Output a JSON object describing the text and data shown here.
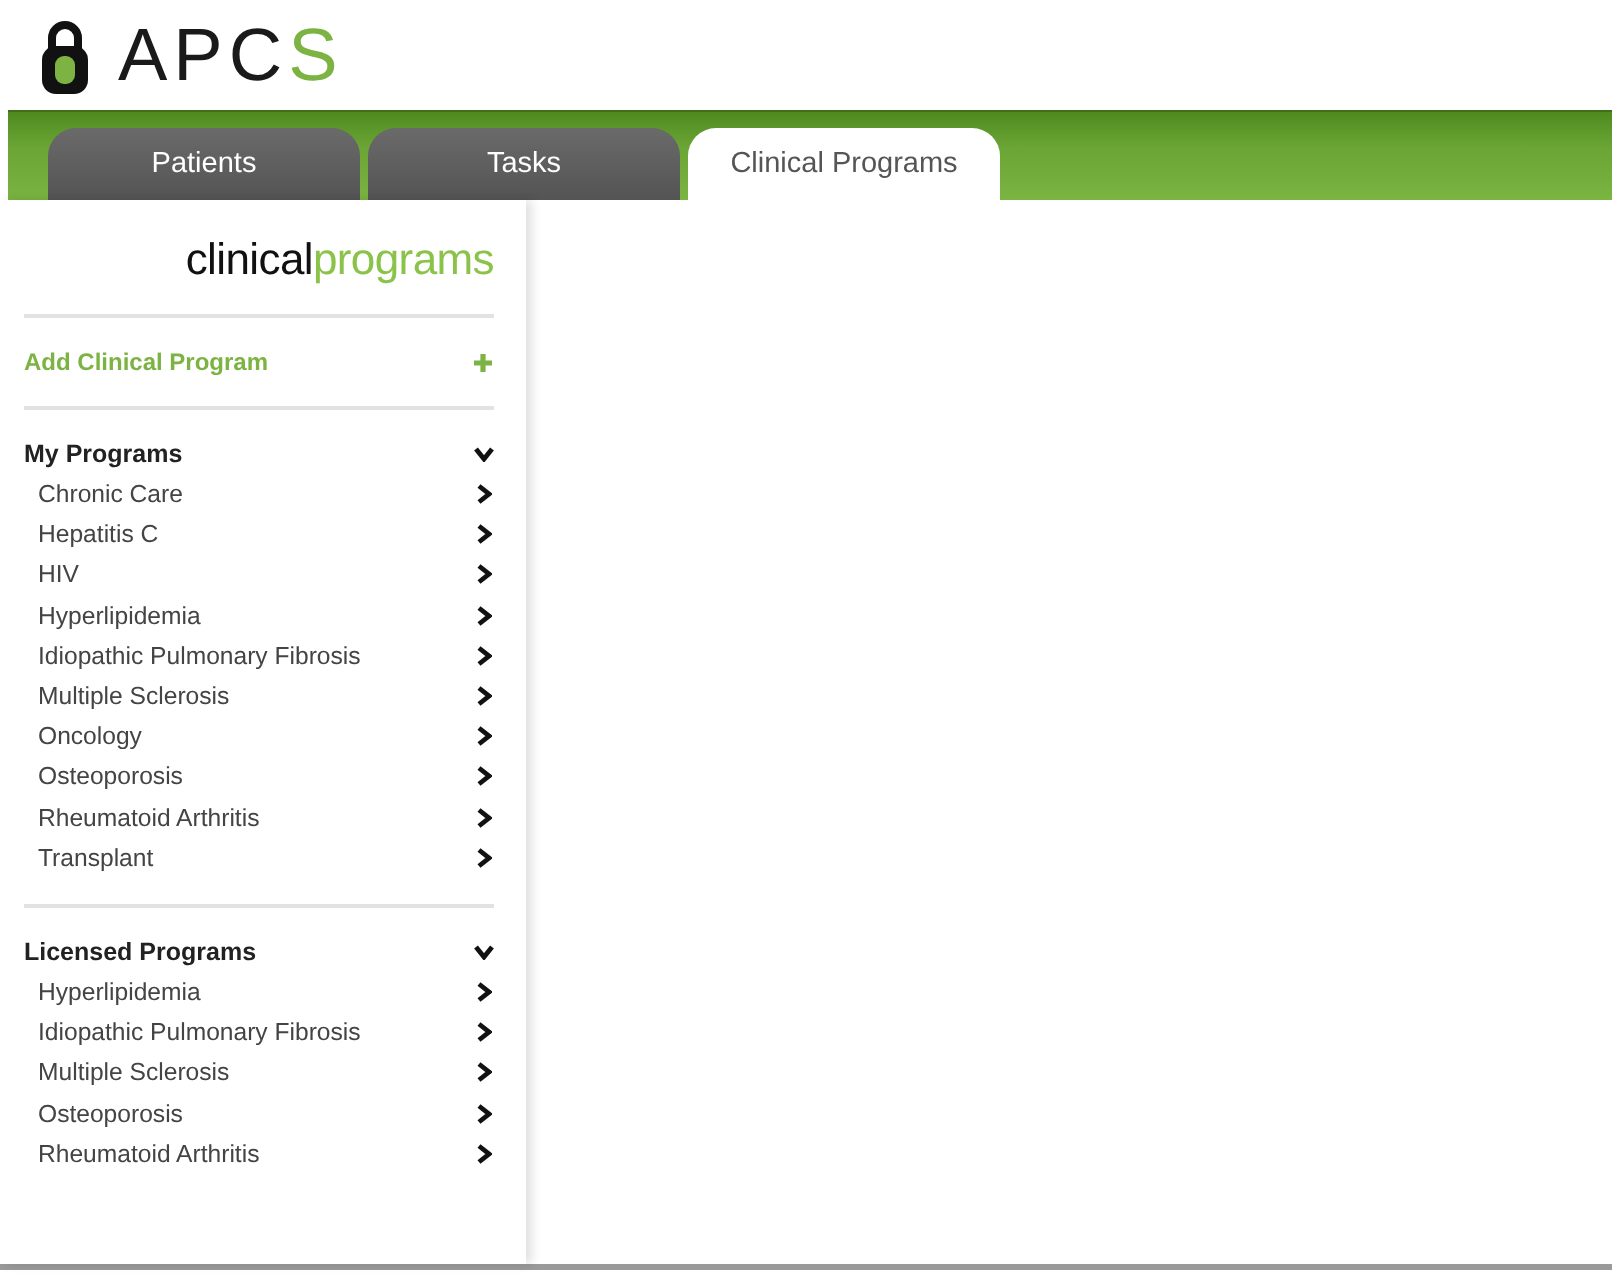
{
  "logo": {
    "text": "APC",
    "accent": "S"
  },
  "tabs": [
    {
      "label": "Patients",
      "selected": false
    },
    {
      "label": "Tasks",
      "selected": false
    },
    {
      "label": "Clinical Programs",
      "selected": true
    }
  ],
  "sidebar": {
    "heading": {
      "text": "clinical",
      "accent": "programs"
    },
    "add_action": {
      "label": "Add Clinical Program"
    },
    "sections": [
      {
        "title": "My Programs",
        "expanded": true,
        "items": [
          "Chronic Care",
          "Hepatitis C",
          "HIV",
          "Hyperlipidemia",
          "Idiopathic Pulmonary Fibrosis",
          "Multiple Sclerosis",
          "Oncology",
          "Osteoporosis",
          "Rheumatoid Arthritis",
          "Transplant"
        ]
      },
      {
        "title": "Licensed Programs",
        "expanded": true,
        "items": [
          "Hyperlipidemia",
          "Idiopathic Pulmonary Fibrosis",
          "Multiple Sclerosis",
          "Osteoporosis",
          "Rheumatoid Arthritis"
        ]
      }
    ]
  }
}
